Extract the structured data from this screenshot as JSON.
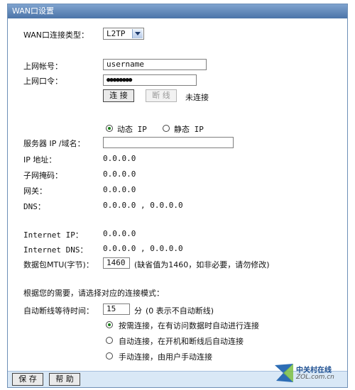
{
  "window": {
    "title": "WAN口设置"
  },
  "wan_type": {
    "label": "WAN口连接类型：",
    "selected": "L2TP"
  },
  "account": {
    "label": "上网帐号：",
    "value": "username"
  },
  "password": {
    "label": "上网口令：",
    "value": "●●●●●●●●"
  },
  "connect": {
    "connect_label": "连 接",
    "disconnect_label": "断 线",
    "status": "未连接"
  },
  "ip_mode": {
    "dynamic_label": "动态 IP",
    "static_label": "静态 IP",
    "selected": "dynamic"
  },
  "server": {
    "label": "服务器 IP /域名：",
    "value": ""
  },
  "status_rows": [
    {
      "label": "IP 地址：",
      "value": "0.0.0.0"
    },
    {
      "label": "子网掩码：",
      "value": "0.0.0.0"
    },
    {
      "label": "网关：",
      "value": "0.0.0.0"
    },
    {
      "label": "DNS：",
      "value": "0.0.0.0 , 0.0.0.0"
    }
  ],
  "internet": {
    "ip_label": "Internet IP：",
    "ip_value": "0.0.0.0",
    "dns_label": "Internet DNS：",
    "dns_value": "0.0.0.0 , 0.0.0.0"
  },
  "mtu": {
    "label": "数据包MTU(字节)：",
    "value": "1460",
    "hint": "(缺省值为1460，如非必要，请勿修改)"
  },
  "mode_prompt": "根据您的需要，请选择对应的连接模式：",
  "idle": {
    "label": "自动断线等待时间：",
    "value": "15",
    "unit": "分",
    "hint": "(0 表示不自动断线)"
  },
  "connect_modes": [
    {
      "label": "按需连接，在有访问数据时自动进行连接",
      "checked": true
    },
    {
      "label": "自动连接，在开机和断线后自动连接",
      "checked": false
    },
    {
      "label": "手动连接，由用户手动连接",
      "checked": false
    }
  ],
  "footer": {
    "save_label": "保 存",
    "help_label": "帮 助"
  },
  "watermark": {
    "brand": "中关村在线",
    "site": "ZOL.com.cn"
  }
}
